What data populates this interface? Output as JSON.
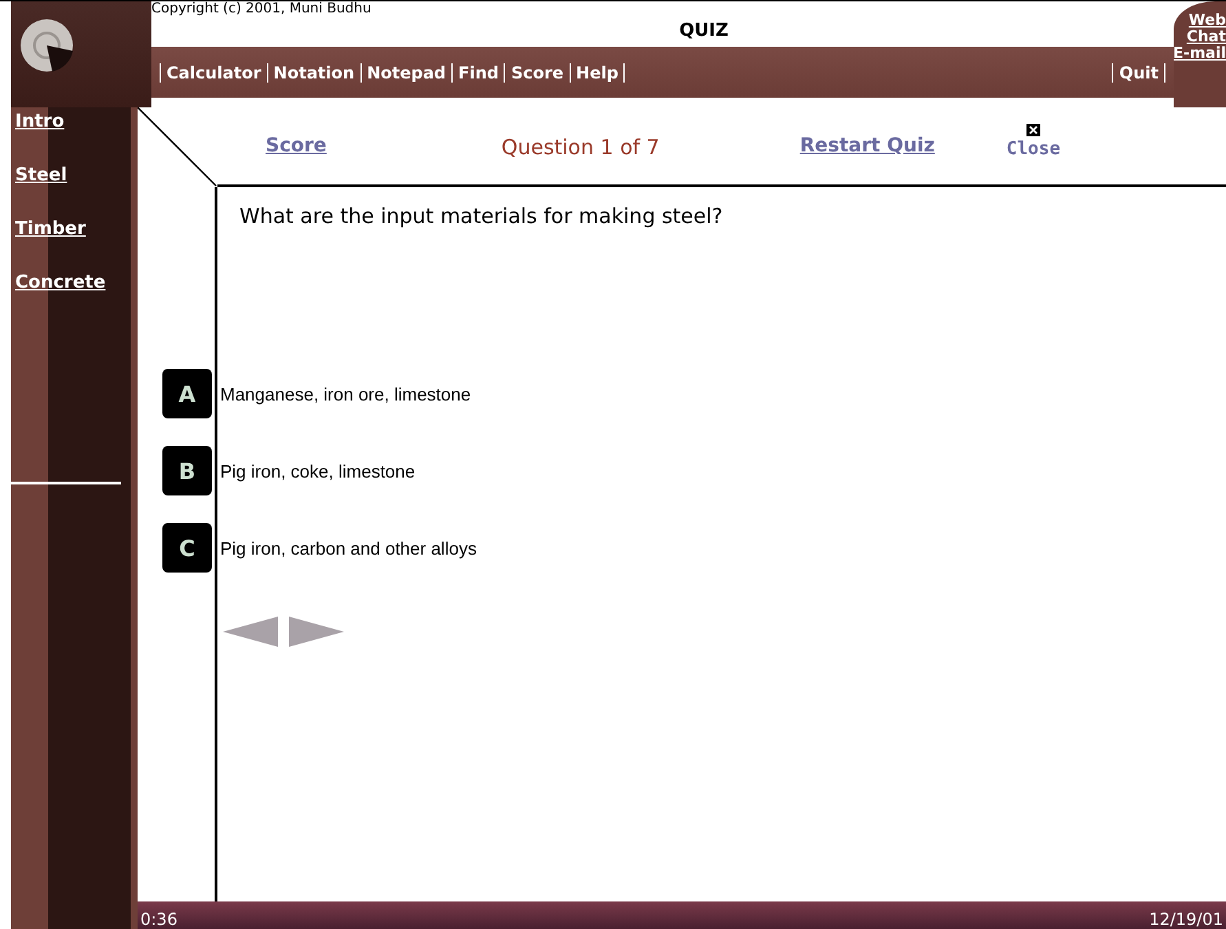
{
  "header": {
    "copyright": "Copyright (c) 2001, Muni Budhu",
    "title": "QUIZ",
    "menu": [
      "Calculator",
      "Notation",
      "Notepad",
      "Find",
      "Score",
      "Help"
    ],
    "quit": "Quit",
    "side_links": [
      "Web",
      "Chat",
      "E-mail"
    ]
  },
  "sidebar": {
    "items": [
      "Intro",
      "Steel",
      "Timber",
      "Concrete"
    ]
  },
  "quiz_nav": {
    "score": "Score",
    "progress": "Question 1 of 7",
    "restart": "Restart Quiz",
    "close": "Close"
  },
  "question": "What are the input materials for making steel?",
  "answers": [
    {
      "letter": "A",
      "text": "Manganese, iron ore, limestone"
    },
    {
      "letter": "B",
      "text": "Pig iron, coke, limestone"
    },
    {
      "letter": "C",
      "text": "Pig iron, carbon and other alloys"
    }
  ],
  "status_bar": {
    "timer": "0:36",
    "date": "12/19/01"
  }
}
